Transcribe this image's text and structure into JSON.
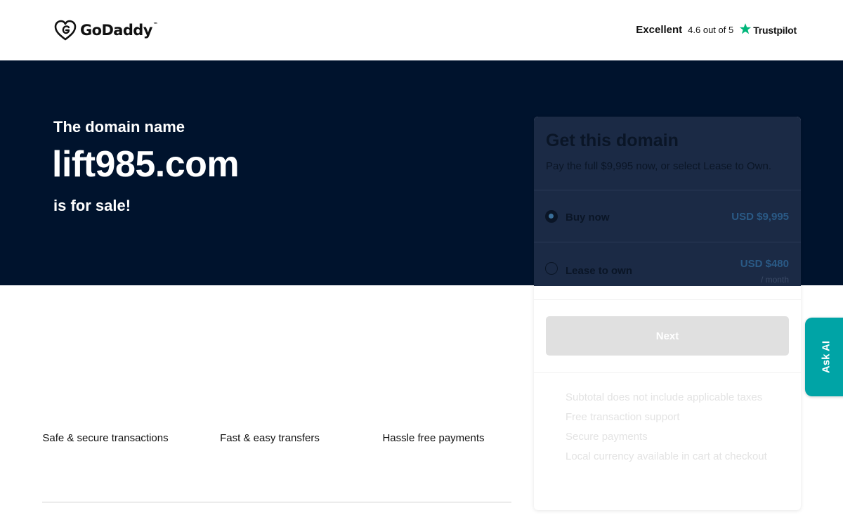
{
  "header": {
    "logo_text": "GoDaddy",
    "logo_tm": "™",
    "rating": {
      "label": "Excellent",
      "score": "4.6 out of 5",
      "provider": "Trustpilot",
      "star_color": "#00b67a"
    }
  },
  "hero": {
    "pre": "The domain name",
    "domain": "lift985.com",
    "post": "is for sale!",
    "bg_color": "#00132d"
  },
  "features": [
    {
      "label": "Safe & secure transactions"
    },
    {
      "label": "Fast & easy transfers"
    },
    {
      "label": "Hassle free payments"
    }
  ],
  "card": {
    "title": "Get this domain",
    "subtitle": "Pay the full $9,995 now, or select Lease to Own.",
    "options": [
      {
        "label": "Buy now",
        "price": "USD $9,995",
        "selected": true
      },
      {
        "label": "Lease to own",
        "price": "USD $480",
        "unit": "/ month",
        "selected": false
      }
    ],
    "next_label": "Next",
    "notes": [
      "Subtotal does not include applicable taxes",
      "Free transaction support",
      "Secure payments",
      "Local currency available in cart at checkout"
    ]
  },
  "ask_ai": {
    "label": "Ask AI",
    "color": "#00a4a6"
  }
}
